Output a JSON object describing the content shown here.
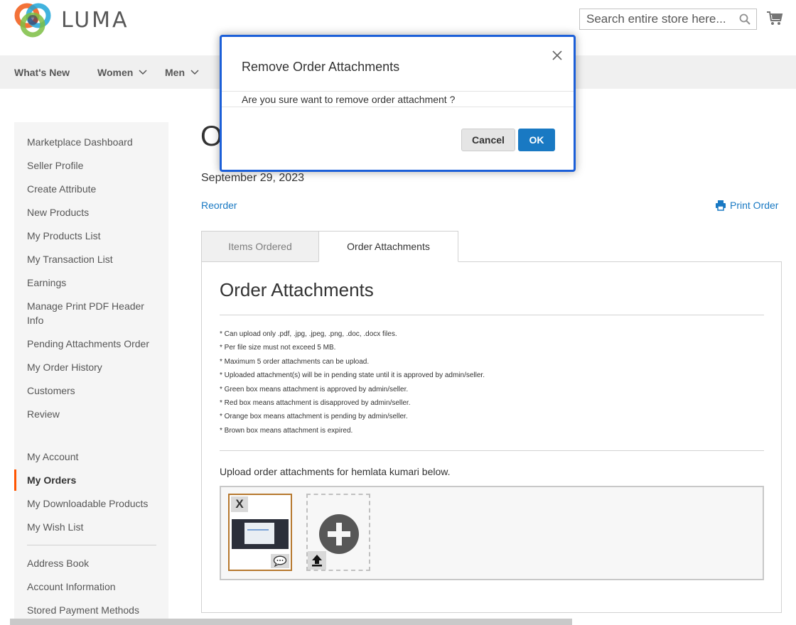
{
  "header": {
    "logo_text": "LUMA",
    "search_placeholder": "Search entire store here...",
    "search_button": "Search"
  },
  "nav": {
    "items": [
      {
        "label": "What's New",
        "has_dropdown": false
      },
      {
        "label": "Women",
        "has_dropdown": true
      },
      {
        "label": "Men",
        "has_dropdown": true
      }
    ]
  },
  "sidebar": {
    "group1": [
      {
        "label": "Marketplace Dashboard"
      },
      {
        "label": "Seller Profile"
      },
      {
        "label": "Create Attribute"
      },
      {
        "label": "New Products"
      },
      {
        "label": "My Products List"
      },
      {
        "label": "My Transaction List"
      },
      {
        "label": "Earnings"
      },
      {
        "label": "Manage Print PDF Header Info"
      },
      {
        "label": "Pending Attachments Order"
      },
      {
        "label": "My Order History"
      },
      {
        "label": "Customers"
      },
      {
        "label": "Review"
      }
    ],
    "group2": [
      {
        "label": "My Account"
      },
      {
        "label": "My Orders",
        "active": true
      },
      {
        "label": "My Downloadable Products"
      },
      {
        "label": "My Wish List"
      }
    ],
    "group3": [
      {
        "label": "Address Book"
      },
      {
        "label": "Account Information"
      },
      {
        "label": "Stored Payment Methods"
      }
    ]
  },
  "order": {
    "heading_fragment": "O",
    "date": "September 29, 2023",
    "reorder_label": "Reorder",
    "print_label": "Print Order"
  },
  "tabs": [
    {
      "label": "Items Ordered",
      "active": false
    },
    {
      "label": "Order Attachments",
      "active": true
    }
  ],
  "attachments": {
    "title": "Order Attachments",
    "rules": [
      "* Can upload only .pdf, .jpg, .jpeg, .png, .doc, .docx files.",
      "* Per file size must not exceed 5 MB.",
      "* Maximum 5 order attachments can be upload.",
      "* Uploaded attachment(s) will be in pending state until it is approved by admin/seller.",
      "* Green box means attachment is approved by admin/seller.",
      "* Red box means attachment is disapproved by admin/seller.",
      "* Orange box means attachment is pending by admin/seller.",
      "* Brown box means attachment is expired."
    ],
    "upload_label": "Upload order attachments for hemlata kumari below.",
    "thumb_remove": "X",
    "colors": {
      "expired_border": "#b6782e"
    }
  },
  "modal": {
    "title": "Remove Order Attachments",
    "message": "Are you sure want to remove order attachment ?",
    "cancel_label": "Cancel",
    "ok_label": "OK"
  },
  "colors": {
    "link": "#1979c3",
    "primary_button": "#1979c3",
    "active_accent": "#ff5501",
    "modal_focus_border": "#1c5fd8"
  }
}
